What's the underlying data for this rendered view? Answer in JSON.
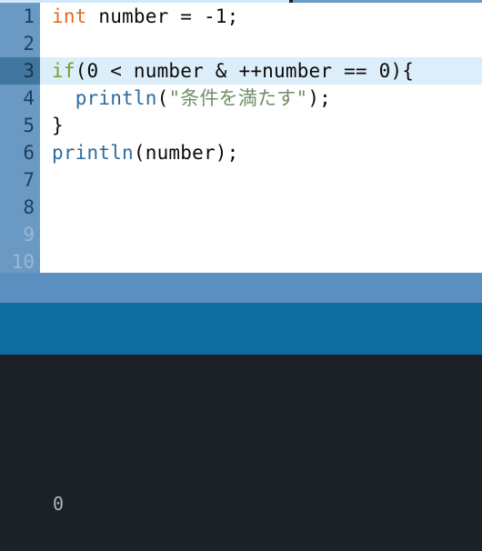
{
  "window": {
    "kind": "code-editor-with-console"
  },
  "top_strip": {
    "left_color": "#cfe8fa",
    "caret_color": "#1c1f26",
    "right_color": "#6a9ac4"
  },
  "editor": {
    "background": "#ffffff",
    "gutter_color": "#6a9ac4",
    "gutter_text_color": "#1d3f60",
    "gutter_dim_text_color": "#9cb8d2",
    "active_gutter_color": "#41779f",
    "active_line_color": "#ddeefb",
    "active_line_number": 3,
    "lines": [
      {
        "number": "1",
        "dim": false,
        "active": false,
        "tokens": [
          {
            "text": "int",
            "kind": "type"
          },
          {
            "text": " number = ",
            "kind": "plain"
          },
          {
            "text": "-1;",
            "kind": "plain"
          }
        ]
      },
      {
        "number": "2",
        "dim": false,
        "active": false,
        "tokens": []
      },
      {
        "number": "3",
        "dim": false,
        "active": true,
        "tokens": [
          {
            "text": "if",
            "kind": "kw"
          },
          {
            "text": "(0 < number & ++number == 0){",
            "kind": "plain"
          }
        ]
      },
      {
        "number": "4",
        "dim": false,
        "active": false,
        "tokens": [
          {
            "text": "  ",
            "kind": "plain"
          },
          {
            "text": "println",
            "kind": "fn"
          },
          {
            "text": "(",
            "kind": "plain"
          },
          {
            "text": "\"条件を満たす\"",
            "kind": "str"
          },
          {
            "text": ");",
            "kind": "plain"
          }
        ]
      },
      {
        "number": "5",
        "dim": false,
        "active": false,
        "tokens": [
          {
            "text": "}",
            "kind": "plain"
          }
        ]
      },
      {
        "number": "6",
        "dim": false,
        "active": false,
        "tokens": [
          {
            "text": "println",
            "kind": "fn"
          },
          {
            "text": "(number);",
            "kind": "plain"
          }
        ]
      },
      {
        "number": "7",
        "dim": false,
        "active": false,
        "tokens": []
      },
      {
        "number": "8",
        "dim": false,
        "active": false,
        "tokens": []
      },
      {
        "number": "9",
        "dim": true,
        "active": false,
        "tokens": []
      },
      {
        "number": "10",
        "dim": true,
        "active": false,
        "tokens": []
      }
    ]
  },
  "bands": {
    "upper_color": "#5b8fc0",
    "lower_color": "#0d6ca0"
  },
  "console": {
    "background": "#1b2127",
    "text_color": "#aab6c2",
    "output": "0"
  }
}
